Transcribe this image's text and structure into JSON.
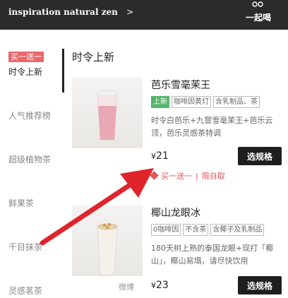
{
  "header": {
    "store_name": "inspiration natural zen",
    "store_chevron": ">",
    "together_label": "一起喝"
  },
  "sidebar": {
    "badge": "买一送一",
    "items": [
      {
        "label": "时令上新"
      },
      {
        "label": "人气推荐榜"
      },
      {
        "label": "超级植物茶"
      },
      {
        "label": "鲜果茶"
      },
      {
        "label": "千目抹茶"
      },
      {
        "label": "灵感茗茶"
      }
    ]
  },
  "main": {
    "section_title": "时令上新",
    "products": [
      {
        "name": "芭乐雪毫茉王",
        "tags": [
          "上新",
          "咖啡因黄灯",
          "含乳制品、茶"
        ],
        "description": "时令白芭乐+九窨雪毫茉王+芭乐云顶，芭乐灵感茶特调",
        "currency": "¥",
        "price": "21",
        "button": "选规格",
        "promo_a": "买一送一",
        "promo_sep": "|",
        "promo_b": "限自取"
      },
      {
        "name": "椰山龙眼冰",
        "tags": [
          "0咖啡因",
          "不含茶",
          "含椰子及乳制品"
        ],
        "description": "180天树上熟的泰国龙眼+现打「椰山」，椰山易塌，请尽快饮用",
        "currency": "¥",
        "price": "23",
        "button": "选规格"
      }
    ]
  },
  "watermark": "微博",
  "colors": {
    "topbar": "#2b2b2b",
    "badge": "#e8676c",
    "new_tag": "#56b56b",
    "arrow": "#e0242b",
    "promo": "#e0565d",
    "button": "#1e1e1e"
  },
  "icons": {
    "together": "people-icon",
    "promo": "tag-icon"
  }
}
